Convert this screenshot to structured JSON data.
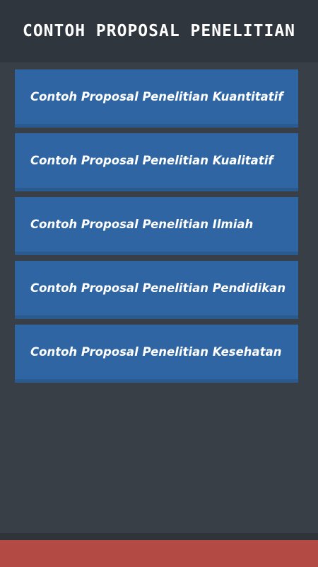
{
  "header": {
    "title": "CONTOH PROPOSAL PENELITIAN"
  },
  "menu": {
    "items": [
      {
        "label": "Contoh Proposal Penelitian Kuantitatif"
      },
      {
        "label": "Contoh Proposal Penelitian Kualitatif"
      },
      {
        "label": "Contoh Proposal Penelitian Ilmiah"
      },
      {
        "label": "Contoh Proposal Penelitian Pendidikan"
      },
      {
        "label": "Contoh Proposal Penelitian Kesehatan"
      }
    ]
  },
  "colors": {
    "header_bg": "#30363d",
    "page_bg": "#383f47",
    "item_bg": "#2f65a3",
    "footer_bar": "#b34a43"
  }
}
